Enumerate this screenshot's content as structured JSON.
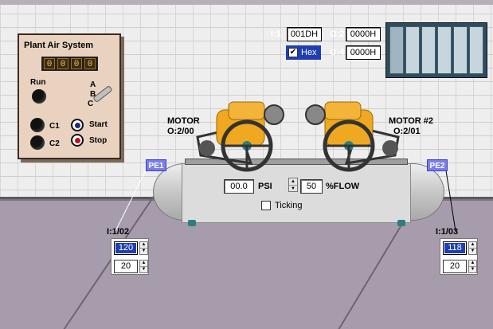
{
  "panel": {
    "title": "Plant Air System",
    "counter_digits": [
      "0",
      "0",
      "0",
      "0"
    ],
    "run_label": "Run",
    "selector_labels": [
      "A",
      "B",
      "C"
    ],
    "c1_label": "C1",
    "c2_label": "C2",
    "start_label": "Start",
    "stop_label": "Stop"
  },
  "io": {
    "input_label": "I:1",
    "input_value": "001DH",
    "output2_label": "O:2",
    "output2_value": "0000H",
    "hex_label": "Hex",
    "hex_checked": "✔",
    "output4_label": "O:4",
    "output4_value": "0000H"
  },
  "motors": {
    "motor1_label": "MOTOR",
    "motor1_address": "O:2/00",
    "motor2_label": "MOTOR #2",
    "motor2_address": "O:2/01"
  },
  "sensors": {
    "pe1": {
      "label": "PE1",
      "address": "I:1/02",
      "value": "120",
      "setpoint": "20"
    },
    "pe2": {
      "label": "PE2",
      "address": "I:1/03",
      "value": "118",
      "setpoint": "20"
    }
  },
  "tank": {
    "psi_value": "00.0",
    "psi_label": "PSI",
    "flow_value": "50",
    "flow_label": "%FLOW",
    "ticking_label": "Ticking"
  },
  "colors": {
    "selected_blue": "#1f3fb0",
    "pe_tag": "#7a7cf0",
    "motor_orange": "#f0a820",
    "stop_red": "#c0101a",
    "start_blue": "#1b2b7a"
  }
}
